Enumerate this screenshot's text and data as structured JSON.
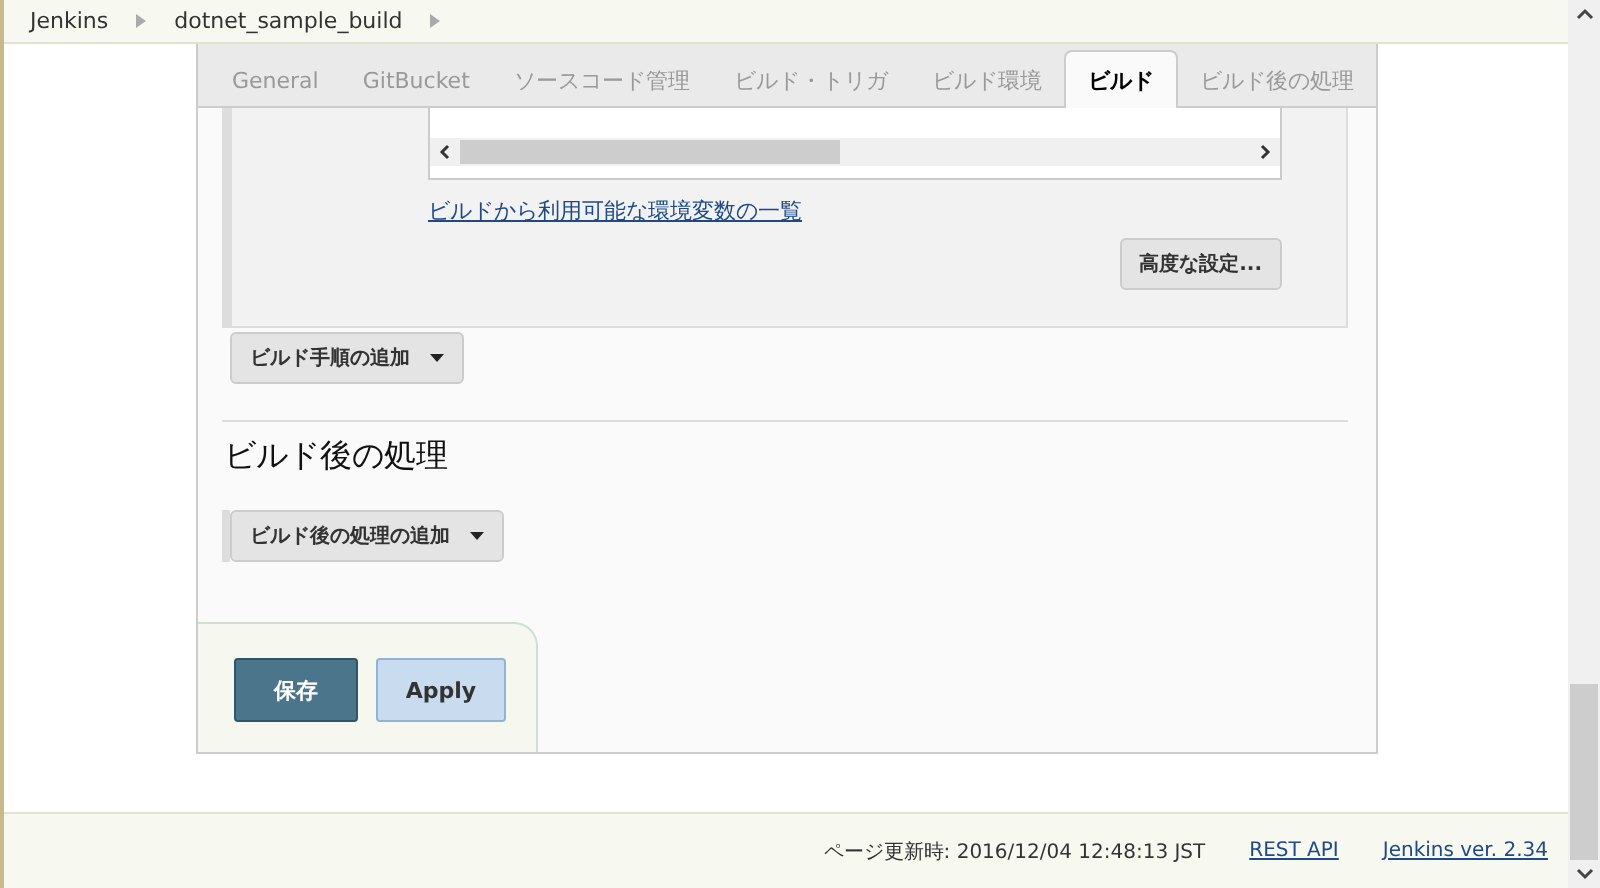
{
  "breadcrumbs": [
    {
      "label": "Jenkins"
    },
    {
      "label": "dotnet_sample_build"
    }
  ],
  "tabs": [
    {
      "label": "General",
      "selected": false
    },
    {
      "label": "GitBucket",
      "selected": false
    },
    {
      "label": "ソースコード管理",
      "selected": false
    },
    {
      "label": "ビルド・トリガ",
      "selected": false
    },
    {
      "label": "ビルド環境",
      "selected": false
    },
    {
      "label": "ビルド",
      "selected": true
    },
    {
      "label": "ビルド後の処理",
      "selected": false
    }
  ],
  "build": {
    "env_link": "ビルドから利用可能な環境変数の一覧",
    "advanced_button": "高度な設定...",
    "add_step_button": "ビルド手順の追加"
  },
  "post_build": {
    "heading": "ビルド後の処理",
    "add_button": "ビルド後の処理の追加"
  },
  "actions": {
    "save": "保存",
    "apply": "Apply"
  },
  "footer": {
    "updated": "ページ更新時: 2016/12/04 12:48:13 JST",
    "links": [
      "REST API",
      "Jenkins ver. 2.34"
    ]
  }
}
